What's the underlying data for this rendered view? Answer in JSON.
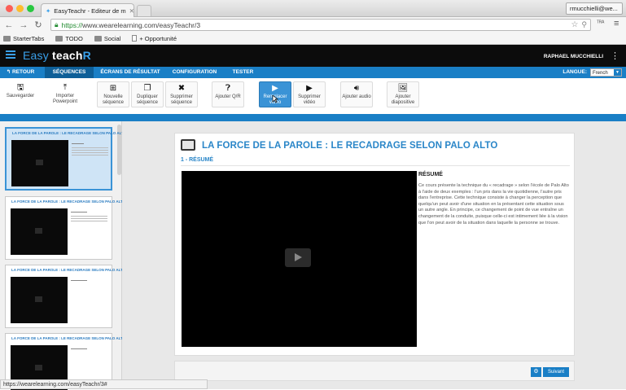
{
  "browser": {
    "tab_title": "EasyTeachr - Editeur de m",
    "profile": "rmucchielli@we...",
    "url_scheme": "https://",
    "url_rest": "www.wearelearning.com/easyTeachr/3",
    "bookmarks": [
      "StarterTabs",
      "TODO",
      "Social",
      "+ Opportunité"
    ],
    "status_url": "https://wearelearning.com/easyTeachr/3#"
  },
  "app": {
    "logo_easy": "Easy",
    "logo_teach": "teach",
    "logo_r": "R",
    "user": "RAPHAEL MUCCHIELLI",
    "more": "⋮"
  },
  "menu": {
    "back": "RETOUR",
    "items": [
      "SÉQUENCES",
      "ÉCRANS DE RÉSULTAT",
      "CONFIGURATION",
      "TESTER"
    ],
    "language_label": "LANGUE:",
    "language_value": "French"
  },
  "toolbar": {
    "save": "Sauvegarder",
    "import_ppt": "Importer Powerpoint",
    "new_seq": "Nouvelle séquence",
    "dup_seq": "Dupliquer séquence",
    "del_seq": "Supprimer séquence",
    "add_qa": "Ajouter Q/R",
    "replace_video": "Remplacer vidéo",
    "del_video": "Supprimer vidéo",
    "add_audio": "Ajouter audio",
    "add_slide": "Ajouter diapositive"
  },
  "slides": [
    {
      "title": "LA FORCE DE LA PAROLE : LE RECADRAGE SELON PALO ALTO"
    },
    {
      "title": "LA FORCE DE LA PAROLE : LE RECADRAGE SELON PALO ALTO"
    },
    {
      "title": "LA FORCE DE LA PAROLE : LE RECADRAGE SELON PALO ALTO"
    },
    {
      "title": "LA FORCE DE LA PAROLE : LE RECADRAGE SELON PALO ALTO"
    }
  ],
  "content": {
    "title": "LA FORCE DE LA PAROLE : LE RECADRAGE SELON PALO ALTO",
    "subtitle": "1 - RÉSUMÉ",
    "summary_title": "RÉSUMÉ",
    "summary_text": "Ce cours présente la technique du « recadrage » selon l'école de Palo Alto à l'aide de deux exemples : l'un pris dans la vie quotidienne, l'autre pris dans l'entreprise. Cette technique consiste à changer la perception que quelqu'un peut avoir d'une situation en la présentant cette situation sous un autre angle. En principe, ce changement de point de vue entraîne un changement de la conduite, puisque celle-ci est intimement liée à la vision que l'on peut avoir de la situation dans laquelle la personne se trouve.",
    "next_button": "Suivant"
  },
  "colors": {
    "accent": "#1a7fc6",
    "dark_menu": "#0e5f98",
    "header": "#0c0c0c"
  }
}
